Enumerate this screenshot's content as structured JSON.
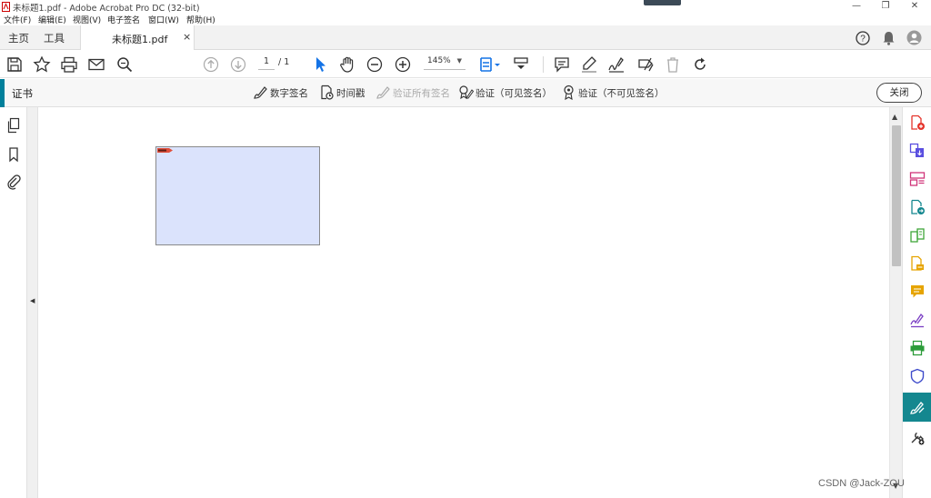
{
  "window": {
    "title": "未标题1.pdf - Adobe Acrobat Pro DC (32-bit)",
    "controls": {
      "minimize": "—",
      "restore": "❐",
      "close": "✕"
    }
  },
  "menu": [
    "文件(F)",
    "编辑(E)",
    "视图(V)",
    "电子签名",
    "窗口(W)",
    "帮助(H)"
  ],
  "tabs": {
    "home": "主页",
    "tools": "工具",
    "document": "未标题1.pdf",
    "close": "×"
  },
  "toolbar": {
    "page_current": "1",
    "page_total": "/ 1",
    "zoom": "145%",
    "icons": [
      "save-icon",
      "bookmark-star-icon",
      "print-icon",
      "email-icon",
      "search-icon",
      "prev-page-icon",
      "next-page-icon",
      "select-cursor-icon",
      "hand-icon",
      "zoom-out-icon",
      "zoom-in-icon",
      "fit-page-icon",
      "scroll-mode-icon",
      "comment-icon",
      "highlight-icon",
      "sign-icon",
      "fill-sign-icon",
      "delete-icon",
      "rotate-icon"
    ]
  },
  "certificates": {
    "title": "证书",
    "digital_sign": "数字签名",
    "timestamp": "时间戳",
    "validate_all": "验证所有签名",
    "validate_visible": "验证（可见签名）",
    "validate_invisible": "验证（不可见签名）",
    "close": "关闭"
  },
  "colors": {
    "accent": "#00809b",
    "active_tool": "#14878f",
    "signature_field": "#dbe3fc"
  },
  "watermark": "CSDN @Jack-ZOU"
}
